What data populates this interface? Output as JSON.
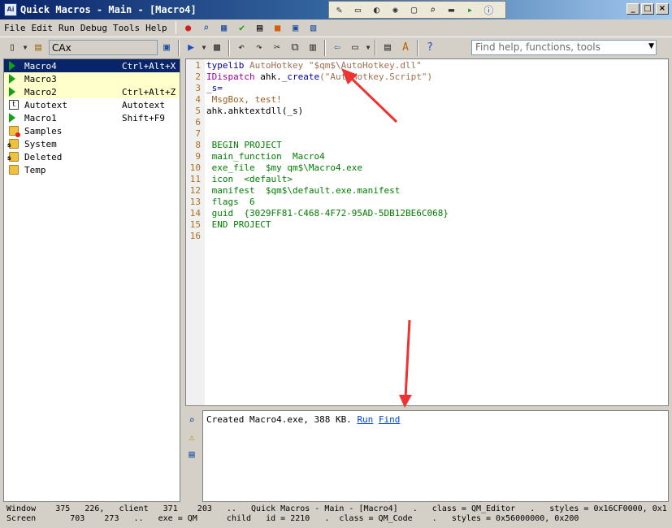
{
  "window": {
    "title": "Quick Macros - Main - [Macro4]",
    "icon_label": "Ai",
    "controls": [
      "_",
      "□",
      "×"
    ]
  },
  "float_toolbar_icons": [
    "pen-icon",
    "keyboard-icon",
    "mouse-icon",
    "wait-icon",
    "window-icon",
    "find-image-icon",
    "control-icon",
    "run-program-icon",
    "info-icon"
  ],
  "menu": {
    "items": [
      "File",
      "Edit",
      "Run",
      "Debug",
      "Tools",
      "Help"
    ]
  },
  "toolbar": {
    "macro_name": "CAx",
    "help_search_placeholder": "Find help, functions, tools"
  },
  "tree": {
    "items": [
      {
        "label": "Macro4",
        "hotkey": "Ctrl+Alt+X",
        "icon": "play-icon",
        "state": "selected"
      },
      {
        "label": "Macro3",
        "hotkey": "",
        "icon": "play-icon",
        "state": "highlight"
      },
      {
        "label": "Macro2",
        "hotkey": "Ctrl+Alt+Z",
        "icon": "play-icon",
        "state": "highlight"
      },
      {
        "label": "Autotext",
        "hotkey": "Autotext",
        "icon": "text-icon",
        "state": ""
      },
      {
        "label": "Macro1",
        "hotkey": "Shift+F9",
        "icon": "play-icon",
        "state": ""
      },
      {
        "label": "Samples",
        "hotkey": "",
        "icon": "folder-icon",
        "state": ""
      },
      {
        "label": "System",
        "hotkey": "",
        "icon": "folder-s-icon",
        "state": ""
      },
      {
        "label": "Deleted",
        "hotkey": "",
        "icon": "folder-s-icon",
        "state": ""
      },
      {
        "label": "Temp",
        "hotkey": "",
        "icon": "folder-icon",
        "state": ""
      }
    ]
  },
  "editor": {
    "lines": [
      {
        "n": "1",
        "parts": [
          [
            "kw",
            "typelib"
          ],
          [
            "str",
            " AutoHotkey \"$qm$\\AutoHotkey.dll\""
          ]
        ]
      },
      {
        "n": "2",
        "parts": [
          [
            "cls",
            "IDispatch"
          ],
          [
            "dark",
            " ahk."
          ],
          [
            "kw",
            "_create"
          ],
          [
            "str",
            "(\"AutoHotkey.Script\")"
          ]
        ]
      },
      {
        "n": "3",
        "parts": [
          [
            "kw",
            "_s="
          ]
        ]
      },
      {
        "n": "4",
        "parts": [
          [
            "brown",
            " MsgBox, test!"
          ]
        ]
      },
      {
        "n": "5",
        "parts": [
          [
            "dark",
            "ahk.ahktextdll(_s)"
          ]
        ]
      },
      {
        "n": "6",
        "parts": []
      },
      {
        "n": "7",
        "parts": []
      },
      {
        "n": "8",
        "parts": [
          [
            "comment",
            " BEGIN PROJECT"
          ]
        ]
      },
      {
        "n": "9",
        "parts": [
          [
            "comment",
            " main_function  Macro4"
          ]
        ]
      },
      {
        "n": "10",
        "parts": [
          [
            "comment",
            " exe_file  $my qm$\\Macro4.exe"
          ]
        ]
      },
      {
        "n": "11",
        "parts": [
          [
            "comment",
            " icon  <default>"
          ]
        ]
      },
      {
        "n": "12",
        "parts": [
          [
            "comment",
            " manifest  $qm$\\default.exe.manifest"
          ]
        ]
      },
      {
        "n": "13",
        "parts": [
          [
            "comment",
            " flags  6"
          ]
        ]
      },
      {
        "n": "14",
        "parts": [
          [
            "comment",
            " guid  {3029FF81-C468-4F72-95AD-5DB12BE6C068}"
          ]
        ]
      },
      {
        "n": "15",
        "parts": [
          [
            "comment",
            " END PROJECT"
          ]
        ]
      },
      {
        "n": "16",
        "parts": []
      }
    ]
  },
  "output": {
    "message": "Created Macro4.exe, 388 KB. ",
    "run_link": "Run",
    "find_link": "Find"
  },
  "status": {
    "line1": "Window    375   226,   client   371    203   ..   Quick Macros - Main - [Macro4]   .   class = QM_Editor   .   styles = 0x16CF0000, 0x1",
    "line2": "Screen       703    273   ..   exe = QM      child   id = 2210   .  class = QM_Code    .   styles = 0x56000000, 0x200"
  },
  "colors": {
    "annotation_arrow": "#ee3333",
    "selection": "#0a246a",
    "highlight": "#ffffcc"
  }
}
